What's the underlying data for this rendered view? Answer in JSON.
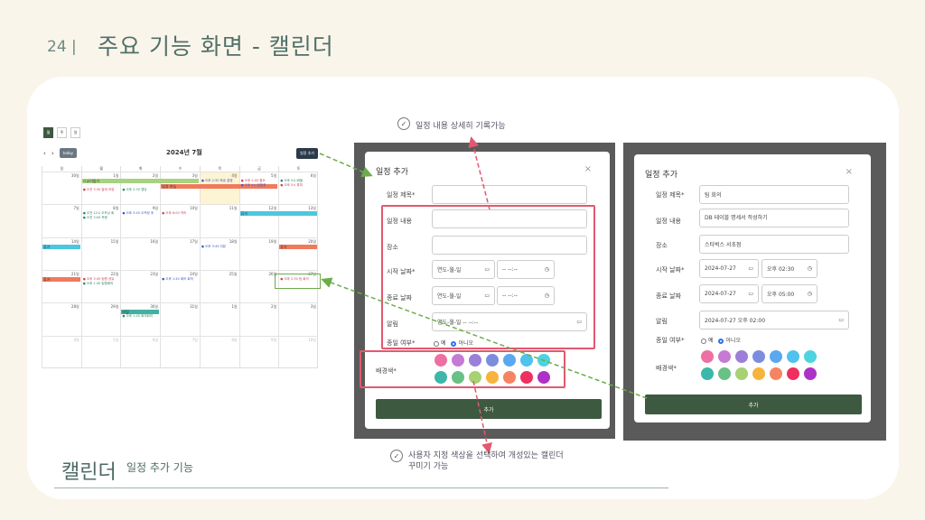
{
  "header": {
    "page_number": "24 |",
    "title": "주요 기능 화면 - 캘린더"
  },
  "footer": {
    "caption_big": "캘린더",
    "caption_small": "일정 추가 기능"
  },
  "annotations": {
    "top": "일정 내용 상세히 기록가능",
    "bottom_line1": "사용자 지정 색상을 선택하여 개성있는 캘린더",
    "bottom_line2": "꾸미기 가능"
  },
  "calendar": {
    "views": [
      "월",
      "주",
      "일"
    ],
    "prev": "‹",
    "next": "›",
    "today_label": "today",
    "month_title": "2024년 7월",
    "add_button": "일정 추가",
    "weekdays": [
      "일",
      "월",
      "화",
      "수",
      "목",
      "금",
      "토"
    ],
    "weeks": [
      [
        "30일",
        "1일",
        "2일",
        "3일",
        "4일",
        "5일",
        "6일"
      ],
      [
        "7일",
        "8일",
        "9일",
        "10일",
        "11일",
        "12일",
        "13일"
      ],
      [
        "14일",
        "15일",
        "16일",
        "17일",
        "18일",
        "19일",
        "20일"
      ],
      [
        "21일",
        "22일",
        "23일",
        "24일",
        "25일",
        "26일",
        "27일"
      ],
      [
        "28일",
        "29일",
        "30일",
        "31일",
        "1일",
        "2일",
        "3일"
      ],
      [
        "4일",
        "5일",
        "6일",
        "7일",
        "8일",
        "9일",
        "10일"
      ]
    ],
    "bars": [
      {
        "label": "ㅁ교기칩기",
        "color": "#a7d37e"
      },
      {
        "label": "일정 연습",
        "color": "#f07a5c"
      },
      {
        "label": "휴가",
        "color": "#4cc7df"
      },
      {
        "label": "휴가",
        "color": "#4cc7df"
      },
      {
        "label": "휴가",
        "color": "#f07a5c"
      },
      {
        "label": "휴가",
        "color": "#f07a5c"
      },
      {
        "label": "미팅",
        "color": "#43b0a4"
      }
    ],
    "events": [
      "● 오전 3:30 알바 모집",
      "● 오후 2:30 앱당",
      "● 오후 2:30 파송 홍엠",
      "● 오후 2:00 월요",
      "● 오후 5시 배필",
      "● 오후 4시 팀원회",
      "● 오후 5시 휴피",
      "● 오전 12시 오프닝 회",
      "● 오후 3:45 오프링 후",
      "● 오후 6:00 약속",
      "● 오전 3:00 측량",
      "● 오후 3:45 리뷰",
      "● 오후 3:45 팀원 공유",
      "● 오후 1:45 팀원회의",
      "● 오후 1:45 회의 회의",
      "● 오후 2:30 팀 회의",
      "● 오후 1:45 회의회의"
    ]
  },
  "modal_empty": {
    "title": "일정 추가",
    "close": "×",
    "fields": {
      "title_label": "일정 제목*",
      "content_label": "일정 내용",
      "place_label": "장소",
      "start_label": "시작 날짜*",
      "end_label": "종료 날짜",
      "alarm_label": "알림",
      "allday_label": "종일 여부*",
      "color_label": "배경색*"
    },
    "date_placeholder": "연도-월-일",
    "time_placeholder": "-- --:--",
    "alarm_placeholder": "연도-월-일 -- --:--",
    "allday_yes": "예",
    "allday_no": "아니오",
    "submit": "추가"
  },
  "modal_filled": {
    "title": "일정 추가",
    "close": "×",
    "fields": {
      "title_label": "일정 제목*",
      "content_label": "일정 내용",
      "place_label": "장소",
      "start_label": "시작 날짜*",
      "end_label": "종료 날짜",
      "alarm_label": "알림",
      "allday_label": "종일 여부*",
      "color_label": "배경색*"
    },
    "title_value": "팀 회의",
    "content_value": "DB 테이블 명세서 작성하기",
    "place_value": "스타벅스 서초점",
    "start_date": "2024-07-27",
    "start_time": "오후 02:30",
    "end_date": "2024-07-27",
    "end_time": "오후 05:00",
    "alarm_value": "2024-07-27 오후 02:00",
    "allday_yes": "예",
    "allday_no": "아니오",
    "submit": "추가"
  },
  "palette_row1": [
    "#ee6fa1",
    "#c57ad4",
    "#9b7fd9",
    "#7d8dde",
    "#5aa8ef",
    "#4fc2ee",
    "#4ed3e0"
  ],
  "palette_row2": [
    "#3db7a9",
    "#69c185",
    "#a6d174",
    "#f7b43c",
    "#f58562",
    "#ee2f5f",
    "#ae31c6"
  ]
}
